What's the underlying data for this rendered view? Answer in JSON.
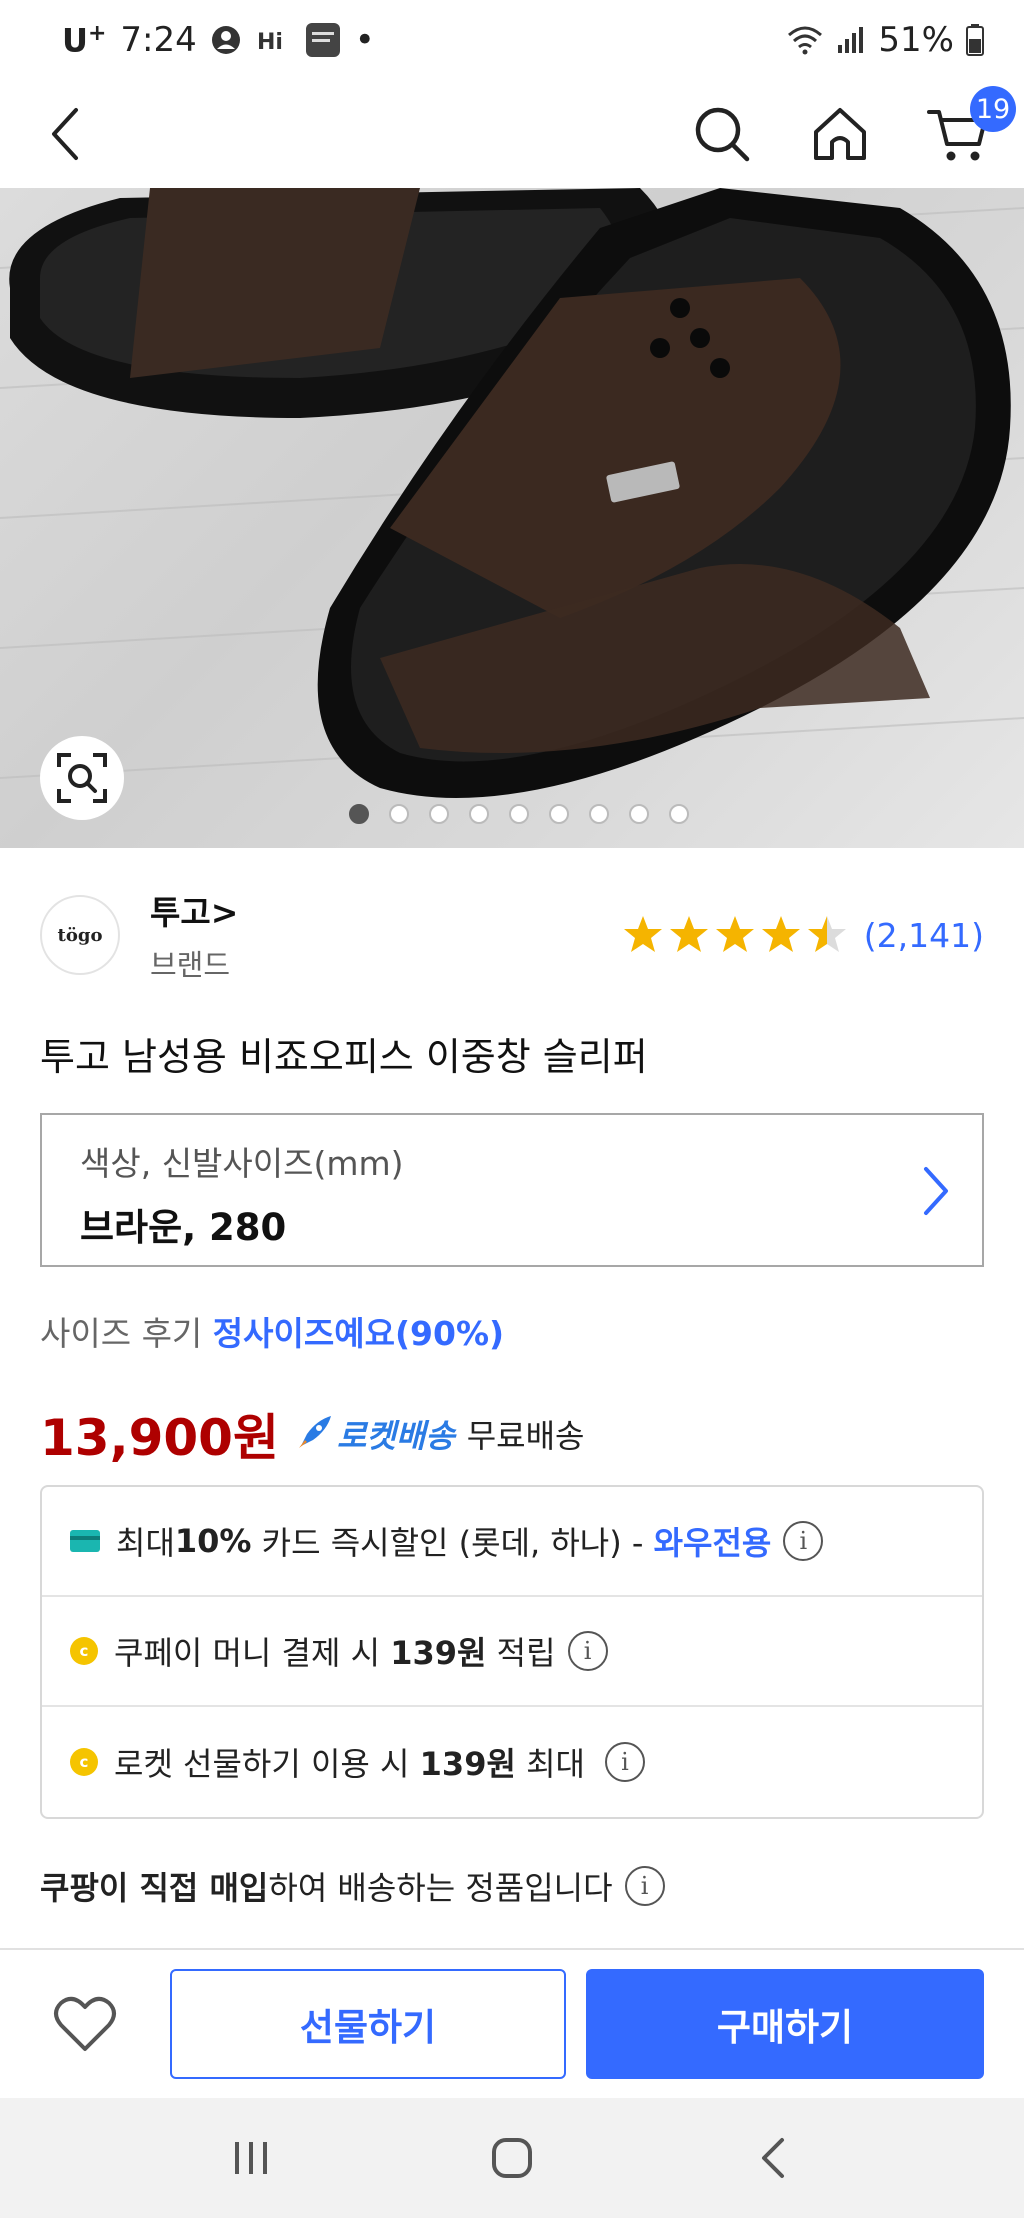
{
  "status_bar": {
    "carrier": "U",
    "carrier_sup": "+",
    "time": "7:24",
    "extra": "•",
    "battery": "51%"
  },
  "header": {
    "cart_count": "19"
  },
  "gallery": {
    "total_images": 9,
    "active_index": 0
  },
  "brand": {
    "logo_text": "tögo",
    "name": "투고>",
    "subtitle": "브랜드"
  },
  "rating": {
    "stars": 4.5,
    "count": "(2,141)"
  },
  "product": {
    "title": "투고 남성용 비죠오피스 이중창 슬리퍼"
  },
  "option": {
    "label": "색상, 신발사이즈(mm)",
    "value": "브라운, 280"
  },
  "size_review": {
    "label": "사이즈 후기",
    "value": "정사이즈예요(90%)"
  },
  "price": {
    "amount": "13,900원",
    "rocket_label": "로켓배송",
    "shipping": "무료배송"
  },
  "benefits": [
    {
      "pre": "최대 ",
      "bold": "10%",
      "post": " 카드 즉시할인 (롯데, 하나) - ",
      "accent": "와우전용"
    },
    {
      "pre": "쿠페이 머니 결제 시 ",
      "bold": "139원",
      "post": " 적립",
      "accent": ""
    },
    {
      "pre": "로켓 선물하기 이용 시 ",
      "bold": "139원",
      "post": " 최대",
      "accent": ""
    }
  ],
  "direct_note": {
    "bold": "쿠팡이 직접 매입",
    "rest": "하여 배송하는 정품입니다"
  },
  "actions": {
    "gift": "선물하기",
    "buy": "구매하기"
  },
  "colors": {
    "accent_blue": "#346aff",
    "price_red": "#ae0000",
    "star_yellow": "#f5b400"
  }
}
